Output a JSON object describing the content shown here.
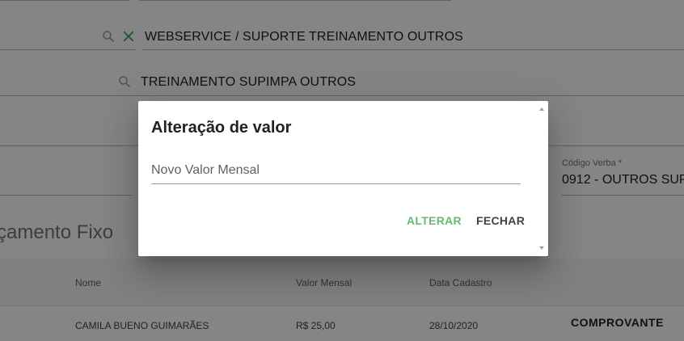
{
  "form": {
    "webservice_value": "WEBSERVICE / SUPORTE TREINAMENTO OUTROS",
    "treinamento_value": "TREINAMENTO SUPIMPA OUTROS",
    "codigo_verba_label": "Código Verba",
    "required_mark": "*",
    "codigo_verba_value": "0912 - OUTROS SUP"
  },
  "section": {
    "title": "çamento Fixo"
  },
  "table": {
    "headers": {
      "nome": "Nome",
      "valor_mensal": "Valor Mensal",
      "data_cadastro": "Data Cadastro"
    },
    "rows": [
      {
        "nome": "CAMILA BUENO GUIMARÃES",
        "valor_mensal": "R$ 25,00",
        "data_cadastro": "28/10/2020",
        "action": "COMPROVANTE"
      }
    ]
  },
  "dialog": {
    "title": "Alteração de valor",
    "input_placeholder": "Novo Valor Mensal",
    "input_value": "",
    "confirm_label": "ALTERAR",
    "close_label": "FECHAR"
  },
  "icons": {
    "search": "search-icon",
    "clear": "clear-icon"
  },
  "colors": {
    "accent_green": "#66bb6a",
    "clear_icon_green": "#43a047",
    "required_red": "#f44336",
    "overlay": "rgba(0,0,0,0.48)"
  }
}
